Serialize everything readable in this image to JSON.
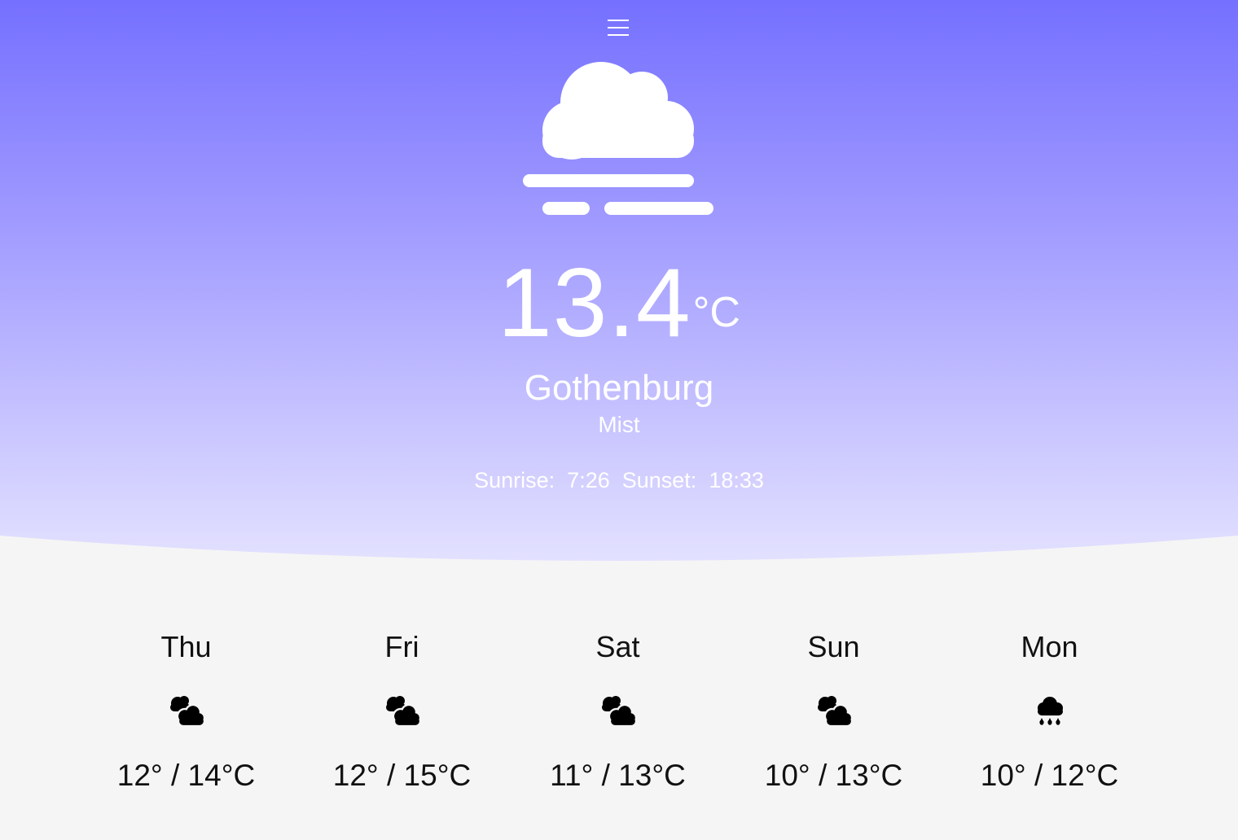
{
  "header": {
    "menu_icon": "hamburger-menu-icon"
  },
  "current": {
    "icon": "mist-icon",
    "temperature": "13.4",
    "unit": "°C",
    "city": "Gothenburg",
    "condition": "Mist",
    "sunrise_label": "Sunrise:",
    "sunrise_time": "7:26",
    "sunset_label": "Sunset:",
    "sunset_time": "18:33"
  },
  "forecast": [
    {
      "day": "Thu",
      "icon": "cloudy-icon",
      "temps": "12° / 14°C"
    },
    {
      "day": "Fri",
      "icon": "cloudy-icon",
      "temps": "12° / 15°C"
    },
    {
      "day": "Sat",
      "icon": "cloudy-icon",
      "temps": "11° / 13°C"
    },
    {
      "day": "Sun",
      "icon": "cloudy-icon",
      "temps": "10° / 13°C"
    },
    {
      "day": "Mon",
      "icon": "rain-icon",
      "temps": "10° / 12°C"
    }
  ],
  "colors": {
    "gradient_top": "#7570ff",
    "gradient_bottom": "#e3e1ff",
    "page_background": "#f5f5f5",
    "text_light": "#ffffff",
    "text_dark": "#111111"
  }
}
